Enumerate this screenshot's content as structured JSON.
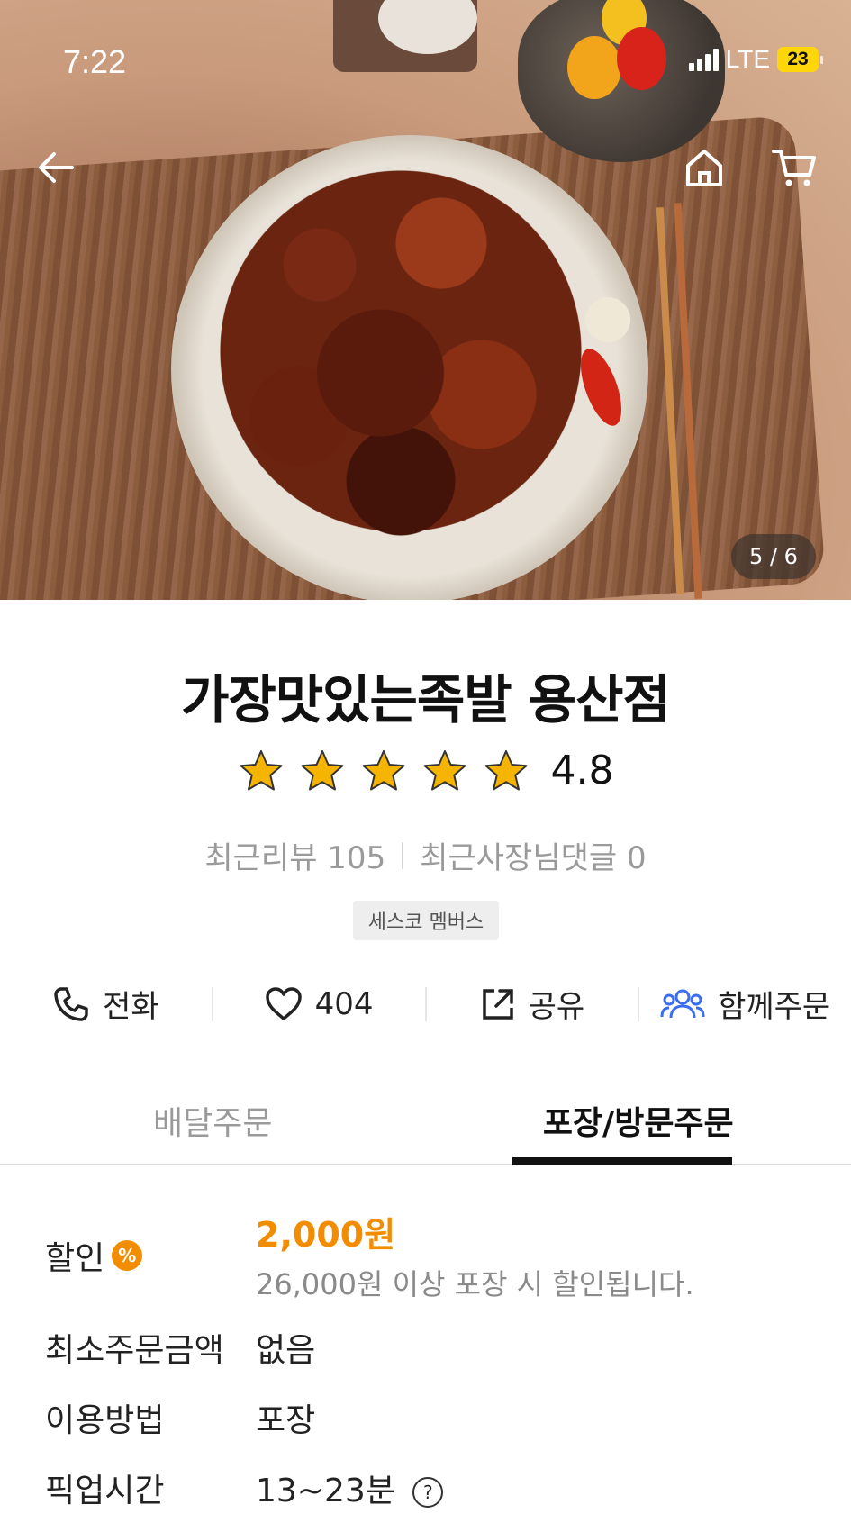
{
  "status_bar": {
    "time": "7:22",
    "network": "LTE",
    "battery": "23"
  },
  "gallery": {
    "pager": "5 / 6"
  },
  "store": {
    "name": "가장맛있는족발 용산점",
    "rating": "4.8",
    "stars_filled": 5,
    "recent_reviews": "최근리뷰 105",
    "owner_replies": "최근사장님댓글 0",
    "badge": "세스코 멤버스"
  },
  "actions": {
    "call": "전화",
    "likes": "404",
    "share": "공유",
    "group_order": "함께주문"
  },
  "tabs": [
    {
      "label": "배달주문",
      "active": false
    },
    {
      "label": "포장/방문주문",
      "active": true
    }
  ],
  "details": {
    "discount_label": "할인",
    "discount_icon": "%",
    "discount_value": "2,000원",
    "discount_note": "26,000원 이상 포장 시 할인됩니다.",
    "min_order_label": "최소주문금액",
    "min_order_value": "없음",
    "method_label": "이용방법",
    "method_value": "포장",
    "pickup_label": "픽업시간",
    "pickup_value": "13~23분",
    "help_icon": "?"
  },
  "colors": {
    "accent": "#f28c00",
    "star": "#f5b400",
    "group_icon": "#3a6df0"
  }
}
